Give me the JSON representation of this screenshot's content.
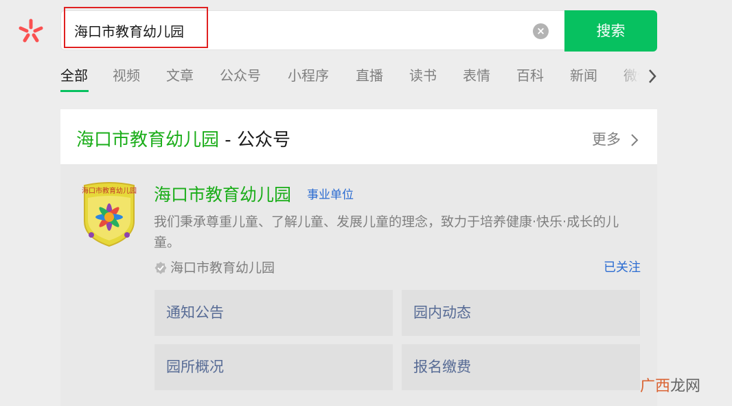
{
  "search": {
    "query": "海口市教育幼儿园",
    "clear_icon": "×",
    "button_label": "搜索"
  },
  "tabs": [
    "全部",
    "视频",
    "文章",
    "公众号",
    "小程序",
    "直播",
    "读书",
    "表情",
    "百科",
    "新闻",
    "微信"
  ],
  "active_tab": "全部",
  "result": {
    "keyword": "海口市教育幼儿园",
    "separator": " - ",
    "section": "公众号",
    "more_label": "更多",
    "account": {
      "name": "海口市教育幼儿园",
      "type_badge": "事业单位",
      "description": "我们秉承尊重儿童、了解儿童、发展儿童的理念，致力于培养健康·快乐·成长的儿童。",
      "verified_by": "海口市教育幼儿园",
      "follow_status": "已关注",
      "logo_text": "海口市教育幼儿园",
      "menu": [
        "通知公告",
        "园内动态",
        "园所概况",
        "报名缴费"
      ]
    }
  },
  "watermark": {
    "a": "广西",
    "b": "龙网"
  },
  "colors": {
    "brand_green": "#07c160",
    "keyword_green": "#1aad19",
    "link_blue": "#2a6bd1",
    "menu_text": "#576b95",
    "highlight_red": "#e02020",
    "logo_red": "#fa5151"
  }
}
